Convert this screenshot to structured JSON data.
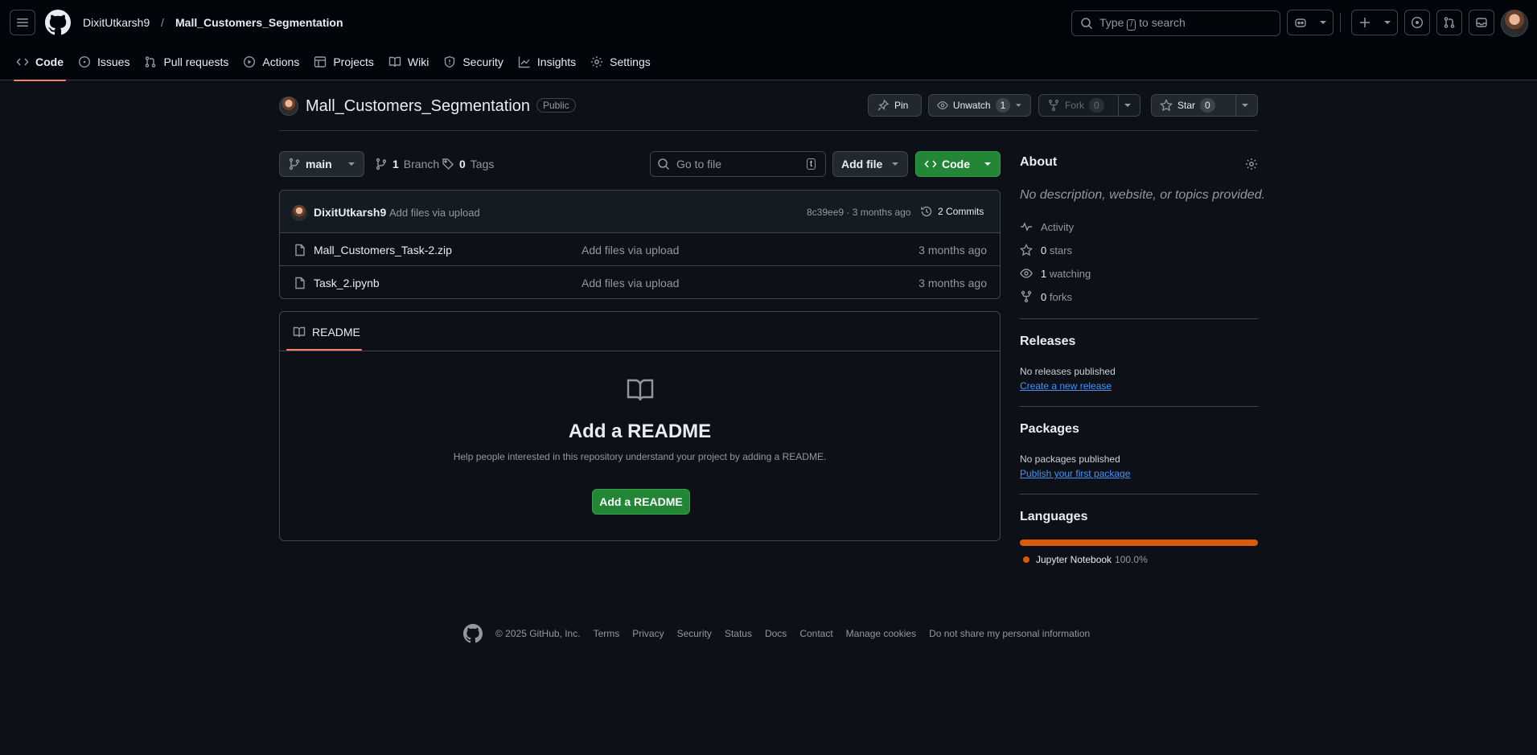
{
  "header": {
    "owner": "DixitUtkarsh9",
    "separator": "/",
    "repo": "Mall_Customers_Segmentation",
    "search_prefix": "Type",
    "search_key": "/",
    "search_suffix": "to search"
  },
  "nav_tabs": [
    {
      "label": "Code",
      "icon": "code-icon",
      "active": true
    },
    {
      "label": "Issues",
      "icon": "issue-icon"
    },
    {
      "label": "Pull requests",
      "icon": "pull-request-icon"
    },
    {
      "label": "Actions",
      "icon": "play-icon"
    },
    {
      "label": "Projects",
      "icon": "table-icon"
    },
    {
      "label": "Wiki",
      "icon": "book-icon"
    },
    {
      "label": "Security",
      "icon": "shield-icon"
    },
    {
      "label": "Insights",
      "icon": "graph-icon"
    },
    {
      "label": "Settings",
      "icon": "gear-icon"
    }
  ],
  "repo_header": {
    "name": "Mall_Customers_Segmentation",
    "visibility": "Public",
    "pin_label": "Pin",
    "unwatch_label": "Unwatch",
    "watch_count": "1",
    "fork_label": "Fork",
    "fork_count": "0",
    "star_label": "Star",
    "star_count": "0"
  },
  "toolbar": {
    "branch": "main",
    "branch_count": "1",
    "branch_label": "Branch",
    "tag_count": "0",
    "tag_label": "Tags",
    "goto_placeholder": "Go to file",
    "goto_key": "t",
    "add_file_label": "Add file",
    "code_label": "Code"
  },
  "latest_commit": {
    "author": "DixitUtkarsh9",
    "message": "Add files via upload",
    "hash_time": "8c39ee9 · 3 months ago",
    "commits_count": "2",
    "commits_label": "Commits"
  },
  "files": [
    {
      "name": "Mall_Customers_Task-2.zip",
      "message": "Add files via upload",
      "time": "3 months ago"
    },
    {
      "name": "Task_2.ipynb",
      "message": "Add files via upload",
      "time": "3 months ago"
    }
  ],
  "readme": {
    "tab_label": "README",
    "title": "Add a README",
    "description": "Help people interested in this repository understand your project by adding a README.",
    "button_label": "Add a README"
  },
  "about": {
    "heading": "About",
    "description": "No description, website, or topics provided.",
    "activity_label": "Activity",
    "stars_count": "0",
    "stars_label": "stars",
    "watching_count": "1",
    "watching_label": "watching",
    "forks_count": "0",
    "forks_label": "forks"
  },
  "releases": {
    "heading": "Releases",
    "empty": "No releases published",
    "link": "Create a new release"
  },
  "packages": {
    "heading": "Packages",
    "empty": "No packages published",
    "link": "Publish your first package"
  },
  "languages": {
    "heading": "Languages",
    "items": [
      {
        "name": "Jupyter Notebook",
        "percent": "100.0%",
        "share": 1.0,
        "color": "#DA5B0B"
      }
    ]
  },
  "footer": {
    "copyright": "© 2025 GitHub, Inc.",
    "links": [
      "Terms",
      "Privacy",
      "Security",
      "Status",
      "Docs",
      "Contact",
      "Manage cookies",
      "Do not share my personal information"
    ]
  },
  "colors": {
    "accent_green": "#238636",
    "tab_underline": "#f78166",
    "link_blue": "#4493f8"
  }
}
